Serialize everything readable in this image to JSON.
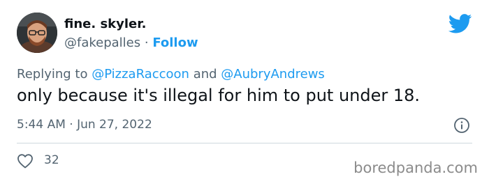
{
  "user": {
    "display_name": "fine. skyler.",
    "handle": "@fakepalles",
    "separator": " · ",
    "follow_label": "Follow"
  },
  "reply": {
    "prefix": "Replying to ",
    "mention_1": "@PizzaRaccoon",
    "conjunction": " and ",
    "mention_2": "@AubryAndrews"
  },
  "tweet": {
    "text": "only because it's illegal for him to put under 18.",
    "timestamp": "5:44 AM · Jun 27, 2022"
  },
  "engagement": {
    "likes": "32"
  },
  "watermark": "boredpanda.com",
  "colors": {
    "accent": "#1d9bf0",
    "secondary_text": "#536471",
    "primary_text": "#0f1419",
    "divider": "#cfd9de"
  },
  "icons": {
    "brand": "twitter-bird-icon",
    "info": "info-icon",
    "like": "heart-icon"
  }
}
